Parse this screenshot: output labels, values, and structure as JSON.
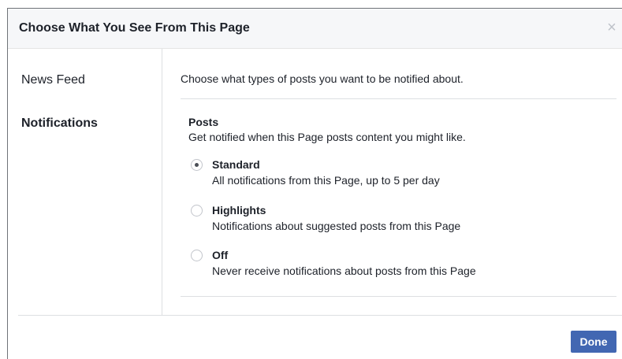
{
  "dialog": {
    "title": "Choose What You See From This Page",
    "close_symbol": "×",
    "close_icon": "close-icon"
  },
  "sidebar": {
    "items": [
      {
        "label": "News Feed",
        "selected": false
      },
      {
        "label": "Notifications",
        "selected": true
      }
    ]
  },
  "content": {
    "intro": "Choose what types of posts you want to be notified about.",
    "section": {
      "title": "Posts",
      "description": "Get notified when this Page posts content you might like."
    },
    "options": [
      {
        "label": "Standard",
        "description": "All notifications from this Page, up to 5 per day",
        "checked": true
      },
      {
        "label": "Highlights",
        "description": "Notifications about suggested posts from this Page",
        "checked": false
      },
      {
        "label": "Off",
        "description": "Never receive notifications about posts from this Page",
        "checked": false
      }
    ]
  },
  "footer": {
    "done_label": "Done"
  },
  "colors": {
    "primary_button": "#4267b2",
    "header_bg": "#f6f7f9",
    "text": "#1d2129"
  }
}
